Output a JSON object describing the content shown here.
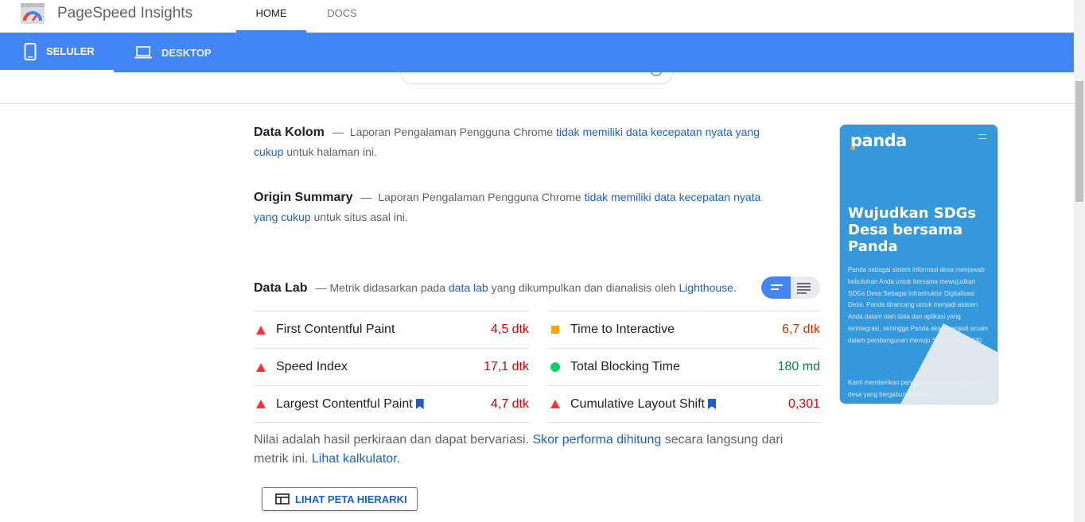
{
  "header": {
    "brand": "PageSpeed Insights",
    "nav": [
      {
        "label": "HOME"
      },
      {
        "label": "DOCS"
      }
    ]
  },
  "device_tabs": [
    {
      "label": "SELULER"
    },
    {
      "label": "DESKTOP"
    }
  ],
  "field_data": {
    "title": "Data Kolom",
    "text_before": "Laporan Pengalaman Pengguna Chrome",
    "link": "tidak memiliki data kecepatan nyata yang cukup",
    "text_after": "untuk halaman ini."
  },
  "origin_summary": {
    "title": "Origin Summary",
    "text_before": "Laporan Pengalaman Pengguna Chrome",
    "link": "tidak memiliki data kecepatan nyata yang cukup",
    "text_after": "untuk situs asal ini."
  },
  "lab_data": {
    "title": "Data Lab",
    "text_before": "Metrik didasarkan pada",
    "link1": "data lab",
    "text_middle": "yang dikumpulkan dan dianalisis oleh",
    "link2": "Lighthouse",
    "text_after": "."
  },
  "metrics_left": [
    {
      "label": "First Contentful Paint",
      "value": "4,5 dtk",
      "status": "fail"
    },
    {
      "label": "Speed Index",
      "value": "17,1 dtk",
      "status": "fail"
    },
    {
      "label": "Largest Contentful Paint",
      "value": "4,7 dtk",
      "status": "fail"
    }
  ],
  "metrics_right": [
    {
      "label": "Time to Interactive",
      "value": "6,7 dtk",
      "status": "average"
    },
    {
      "label": "Total Blocking Time",
      "value": "180 md",
      "status": "pass"
    },
    {
      "label": "Cumulative Layout Shift",
      "value": "0,301",
      "status": "fail"
    }
  ],
  "note": {
    "text1": "Nilai adalah hasil perkiraan dan dapat bervariasi.",
    "link1": "Skor performa dihitung",
    "text2": "secara langsung dari metrik ini.",
    "link2": "Lihat kalkulator."
  },
  "treemap_button": "LIHAT PETA HIERARKI",
  "thumbnail": {
    "logo": "panda",
    "headline": "Wujudkan SDGs Desa bersama Panda",
    "paragraph1": "Panda sebagai sistem informasi desa menjawab kebutuhan Anda untuk bersama mewujudkan SDGs Desa Sebagai Infrastruktur Digitalisasi Desa. Panda dirancang untuk menjadi asisten Anda dalam olah data dan  aplikasi yang terintegrasi, sehingga Panda akan menjadi acuan dalam pembangunan menuju SDGs Desa 2030",
    "paragraph2": "Kami memberikan pendampingan intens untuk desa yang bergabung bersama"
  },
  "colors": {
    "accent": "#4285f4",
    "fail": "#ff3333",
    "average": "#ffa400",
    "pass": "#0cce6b",
    "link": "#1a5fcc"
  },
  "icons": {
    "logo": "pagespeed-gauge-icon",
    "mobile": "phone-icon",
    "desktop": "laptop-icon",
    "toggle_expanded": "list-expanded-icon",
    "toggle_collapsed": "list-collapsed-icon",
    "treemap": "treemap-icon",
    "bookmark": "bookmark-icon"
  }
}
